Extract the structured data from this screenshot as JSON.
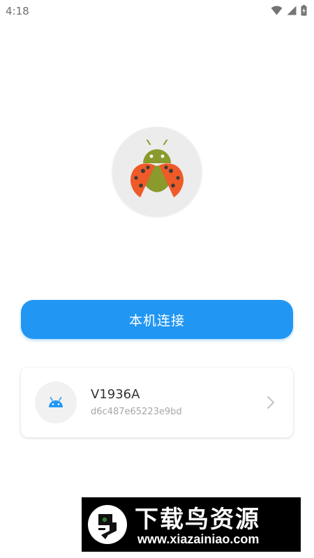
{
  "status_bar": {
    "time": "4:18"
  },
  "main": {
    "connect_button_label": "本机连接"
  },
  "device": {
    "name": "V1936A",
    "serial": "d6c487e65223e9bd"
  },
  "watermark": {
    "title": "下载鸟资源",
    "url": "www.xiazainiao.com"
  },
  "colors": {
    "accent": "#2196f3",
    "logo_body_green": "#8a9a2c",
    "logo_wing_orange": "#ee5a28"
  },
  "icons": {
    "status": [
      "wifi-icon",
      "cellular-signal-icon",
      "battery-icon"
    ],
    "app_logo": "ladybug-android-logo",
    "device_avatar": "android-head-icon",
    "device_card_action": "chevron-right-icon"
  }
}
